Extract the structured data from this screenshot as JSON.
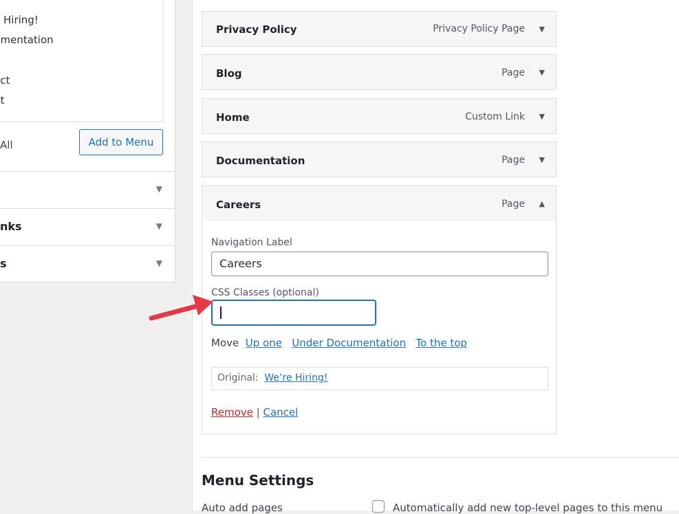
{
  "left": {
    "page_list": [
      {
        "label": "e Hiring!"
      },
      {
        "label": "umentation"
      },
      {
        "label": "act"
      },
      {
        "label": "ut"
      }
    ],
    "select_all": "All",
    "add_to_menu": "Add to Menu",
    "accordion": [
      {
        "label": ""
      },
      {
        "label": "nks"
      },
      {
        "label": "s"
      }
    ]
  },
  "menu_items": [
    {
      "title": "Privacy Policy",
      "type": "Privacy Policy Page"
    },
    {
      "title": "Blog",
      "type": "Page"
    },
    {
      "title": "Home",
      "type": "Custom Link"
    },
    {
      "title": "Documentation",
      "type": "Page"
    },
    {
      "title": "Careers",
      "type": "Page"
    }
  ],
  "item_settings": {
    "nav_label_title": "Navigation Label",
    "nav_label_value": "Careers",
    "css_label": "CSS Classes (optional)",
    "css_value": "",
    "move_label": "Move",
    "move_links": [
      "Up one",
      "Under Documentation",
      "To the top"
    ],
    "original_label": "Original:",
    "original_link": "We’re Hiring!",
    "remove": "Remove",
    "separator": "|",
    "cancel": "Cancel"
  },
  "menu_settings": {
    "title": "Menu Settings",
    "auto_add_label": "Auto add pages",
    "auto_add_checkbox_label": "Automatically add new top-level pages to this menu"
  },
  "icons": {
    "collapse": "triangle-down-icon",
    "expand": "triangle-up-icon",
    "annotation": "red-arrow-icon"
  },
  "colors": {
    "accent": "#2271b1",
    "remove": "#b32d2e",
    "annotation": "#e63946"
  }
}
